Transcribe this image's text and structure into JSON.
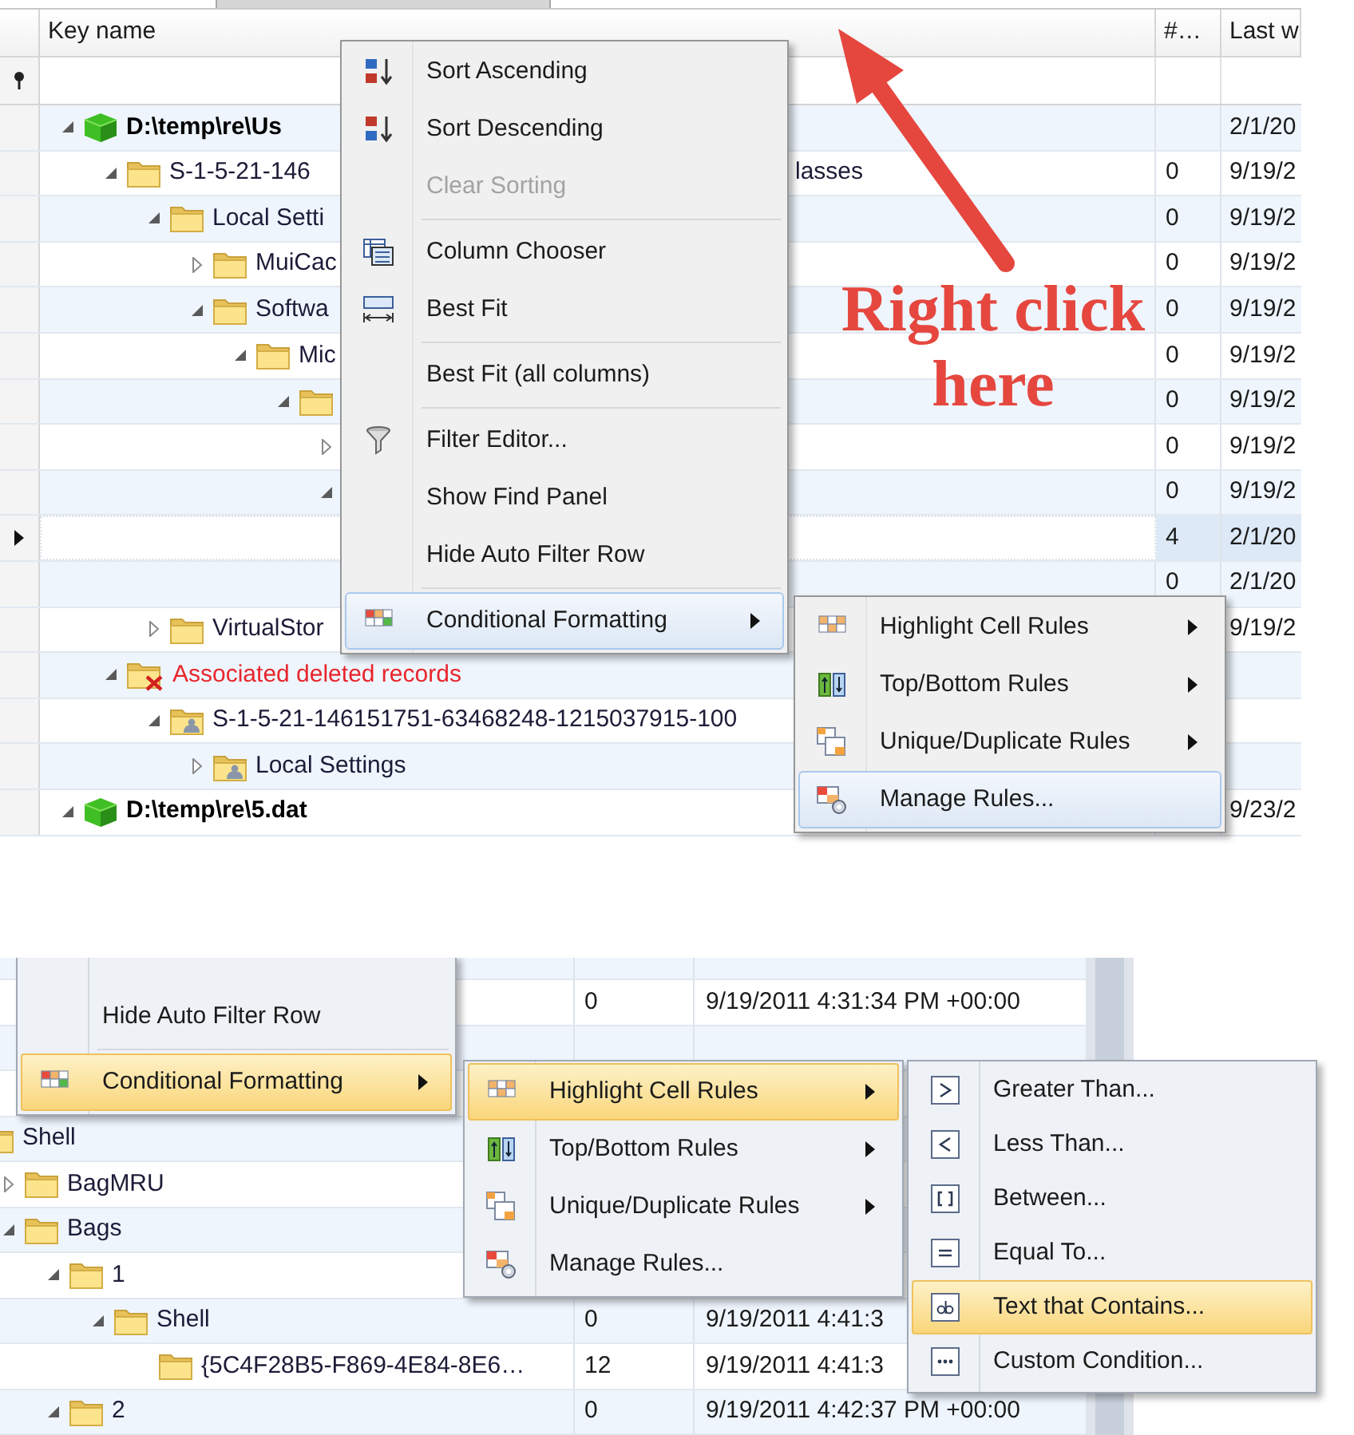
{
  "top": {
    "columns": [
      "Key name",
      "#…",
      "Last w"
    ],
    "tree": [
      {
        "kind": "drive",
        "name": "D:\\temp\\re\\Us",
        "expanded": true,
        "date": "2/1/20",
        "selected": false,
        "children": [
          {
            "kind": "folder",
            "name": "S-1-5-21-146",
            "tail": "lasses",
            "expanded": true,
            "count": "0",
            "date": "9/19/2",
            "selected": false,
            "children": [
              {
                "kind": "folder",
                "name": "Local Setti",
                "expanded": true,
                "count": "0",
                "date": "9/19/2",
                "selected": false,
                "children": [
                  {
                    "kind": "folder",
                    "name": "MuiCac",
                    "expanded": false,
                    "count": "0",
                    "date": "9/19/2",
                    "selected": false
                  },
                  {
                    "kind": "folder",
                    "name": "Softwa",
                    "expanded": true,
                    "count": "0",
                    "date": "9/19/2",
                    "selected": false,
                    "children": [
                      {
                        "kind": "folder",
                        "name": "Mic",
                        "expanded": true,
                        "count": "0",
                        "date": "9/19/2",
                        "selected": false,
                        "children": [
                          {
                            "kind": "folder",
                            "expanded": true,
                            "count": "0",
                            "date": "9/19/2",
                            "selected": false,
                            "children": [
                              {
                                "expanded": false,
                                "count": "0",
                                "date": "9/19/2",
                                "selected": false
                              },
                              {
                                "expanded": true,
                                "count": "0",
                                "date": "9/19/2",
                                "selected": false,
                                "children": [
                                  {
                                    "count": "4",
                                    "date": "2/1/20",
                                    "selected": true
                                  },
                                  {
                                    "count": "0",
                                    "date": "2/1/20",
                                    "selected": false
                                  }
                                ]
                              }
                            ]
                          }
                        ]
                      }
                    ]
                  }
                ]
              },
              {
                "kind": "folder",
                "name": "VirtualStor",
                "expanded": false,
                "date": "9/19/2",
                "selected": false
              }
            ]
          },
          {
            "kind": "deleted",
            "name": "Associated deleted records",
            "expanded": true,
            "selected": false,
            "children": [
              {
                "kind": "user",
                "name": "S-1-5-21-146151751-63468248-1215037915-100",
                "expanded": true,
                "selected": false,
                "children": [
                  {
                    "kind": "user",
                    "name": "Local Settings",
                    "expanded": false,
                    "selected": false
                  }
                ]
              }
            ]
          }
        ]
      },
      {
        "kind": "drive",
        "name": "D:\\temp\\re\\5.dat",
        "expanded": true,
        "date": "9/23/2",
        "selected": false
      }
    ],
    "context_menu": [
      {
        "kind": "item",
        "label": "Sort Ascending",
        "selected": false,
        "disabled": false,
        "submenu": false
      },
      {
        "kind": "item",
        "label": "Sort Descending",
        "selected": false,
        "disabled": false,
        "submenu": false
      },
      {
        "kind": "item",
        "label": "Clear Sorting",
        "selected": false,
        "disabled": true,
        "submenu": false
      },
      {
        "kind": "separator"
      },
      {
        "kind": "item",
        "label": "Column Chooser",
        "selected": false,
        "disabled": false,
        "submenu": false
      },
      {
        "kind": "item",
        "label": "Best Fit",
        "selected": false,
        "disabled": false,
        "submenu": false
      },
      {
        "kind": "separator"
      },
      {
        "kind": "item",
        "label": "Best Fit (all columns)",
        "selected": false,
        "disabled": false,
        "submenu": false
      },
      {
        "kind": "separator"
      },
      {
        "kind": "item",
        "label": "Filter Editor...",
        "selected": false,
        "disabled": false,
        "submenu": false
      },
      {
        "kind": "item",
        "label": "Show Find Panel",
        "selected": false,
        "disabled": false,
        "submenu": false
      },
      {
        "kind": "item",
        "label": "Hide Auto Filter Row",
        "selected": false,
        "disabled": false,
        "submenu": false
      },
      {
        "kind": "separator"
      },
      {
        "kind": "item",
        "label": "Conditional Formatting",
        "selected": true,
        "disabled": false,
        "submenu": true
      }
    ],
    "submenu": [
      {
        "kind": "item",
        "label": "Highlight Cell Rules",
        "selected": false,
        "submenu": true
      },
      {
        "kind": "item",
        "label": "Top/Bottom Rules",
        "selected": false,
        "submenu": true
      },
      {
        "kind": "item",
        "label": "Unique/Duplicate Rules",
        "selected": false,
        "submenu": true
      },
      {
        "kind": "item",
        "label": "Manage Rules...",
        "selected": true,
        "submenu": false
      }
    ],
    "annotation": "Right click here"
  },
  "bottom": {
    "rows_above": [
      {
        "count": "0",
        "date": "9/19/2011 4:31:34 PM +00:00"
      }
    ],
    "tree": [
      {
        "kind": "folder",
        "name": "Shell",
        "children": [
          {
            "kind": "folder",
            "name": "BagMRU",
            "expanded": false
          },
          {
            "kind": "folder",
            "name": "Bags",
            "expanded": true,
            "children": [
              {
                "kind": "folder",
                "name": "1",
                "expanded": true,
                "children": [
                  {
                    "kind": "folder",
                    "name": "Shell",
                    "expanded": true,
                    "count": "0",
                    "date": "9/19/2011 4:41:3",
                    "children": [
                      {
                        "kind": "folder",
                        "name": "{5C4F28B5-F869-4E84-8E6…",
                        "count": "12",
                        "date": "9/19/2011 4:41:3"
                      }
                    ]
                  }
                ]
              },
              {
                "kind": "folder",
                "name": "2",
                "expanded": true,
                "count": "0",
                "date": "9/19/2011 4:42:37 PM +00:00"
              }
            ]
          }
        ]
      }
    ],
    "context_menu": [
      {
        "kind": "item",
        "label": "Hide Auto Filter Row",
        "selected": false,
        "submenu": false
      },
      {
        "kind": "separator"
      },
      {
        "kind": "item",
        "label": "Conditional Formatting",
        "selected": true,
        "submenu": true
      }
    ],
    "submenu": [
      {
        "kind": "item",
        "label": "Highlight Cell Rules",
        "selected": true,
        "submenu": true
      },
      {
        "kind": "item",
        "label": "Top/Bottom Rules",
        "selected": false,
        "submenu": true
      },
      {
        "kind": "item",
        "label": "Unique/Duplicate Rules",
        "selected": false,
        "submenu": true
      },
      {
        "kind": "item",
        "label": "Manage Rules...",
        "selected": false,
        "submenu": false
      }
    ],
    "rules_menu": [
      {
        "kind": "item",
        "label": "Greater Than...",
        "selected": false
      },
      {
        "kind": "item",
        "label": "Less Than...",
        "selected": false
      },
      {
        "kind": "item",
        "label": "Between...",
        "selected": false
      },
      {
        "kind": "item",
        "label": "Equal To...",
        "selected": false
      },
      {
        "kind": "item",
        "label": "Text that Contains...",
        "selected": true
      },
      {
        "kind": "item",
        "label": "Custom Condition...",
        "selected": false
      }
    ]
  }
}
